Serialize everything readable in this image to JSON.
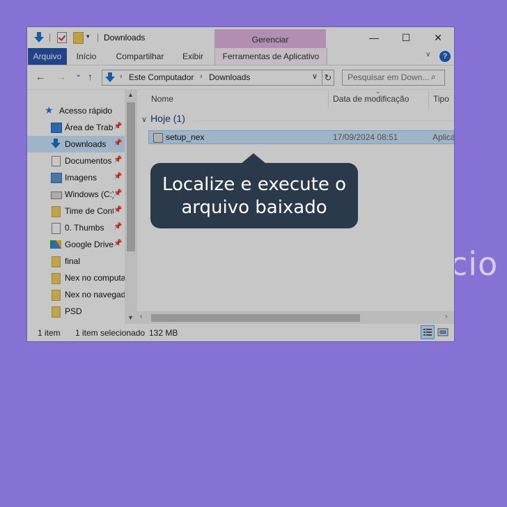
{
  "background_text": "cio",
  "colors": {
    "background": "#8672d4",
    "tooltip_bg": "#2b3a4a",
    "selection": "#cce8ff",
    "file_tab": "#2956b2",
    "manage_tab": "#e6b7e6"
  },
  "titlebar": {
    "title": "Downloads",
    "manage_tab": "Gerenciar",
    "controls": {
      "minimize": "—",
      "maximize": "☐",
      "close": "✕"
    }
  },
  "ribbon": {
    "tabs": [
      "Arquivo",
      "Início",
      "Compartilhar",
      "Exibir",
      "Ferramentas de Aplicativo"
    ],
    "help": "?"
  },
  "address": {
    "back": "←",
    "forward": "→",
    "recent": "⌄",
    "up": "↑",
    "crumbs": [
      "Este Computador",
      "Downloads"
    ],
    "separator": "›",
    "refresh": "↻",
    "search_placeholder": "Pesquisar em Down...",
    "search_icon": "⌕"
  },
  "sidebar": {
    "items": [
      {
        "label": "Acesso rápido",
        "icon": "star-icon"
      },
      {
        "label": "Área de Traba",
        "icon": "desktop-icon",
        "pinned": true
      },
      {
        "label": "Downloads",
        "icon": "download-icon",
        "pinned": true,
        "selected": true
      },
      {
        "label": "Documentos",
        "icon": "documents-icon",
        "pinned": true
      },
      {
        "label": "Imagens",
        "icon": "pictures-icon",
        "pinned": true
      },
      {
        "label": "Windows (C:)",
        "icon": "drive-icon",
        "pinned": true
      },
      {
        "label": "Time de Cont",
        "icon": "folder-icon",
        "pinned": true
      },
      {
        "label": "0. Thumbs",
        "icon": "user-folder-icon",
        "pinned": true
      },
      {
        "label": "Google Drive",
        "icon": "google-drive-icon",
        "pinned": true
      },
      {
        "label": "final",
        "icon": "folder-icon"
      },
      {
        "label": "Nex no computa",
        "icon": "folder-icon"
      },
      {
        "label": "Nex no navegad",
        "icon": "folder-icon"
      },
      {
        "label": "PSD",
        "icon": "folder-icon"
      }
    ],
    "pin_glyph": "📌"
  },
  "content": {
    "columns": [
      "Nome",
      "Data de modificação",
      "Tipo"
    ],
    "group": "Hoje (1)",
    "group_chevron": "∨",
    "files": [
      {
        "name": "setup_nex",
        "date": "17/09/2024 08:51",
        "type": "Aplica"
      }
    ]
  },
  "status": {
    "count": "1 item",
    "selected": "1 item selecionado",
    "size": "132 MB"
  },
  "tooltip": {
    "line1": "Localize e execute o",
    "line2": "arquivo baixado"
  }
}
